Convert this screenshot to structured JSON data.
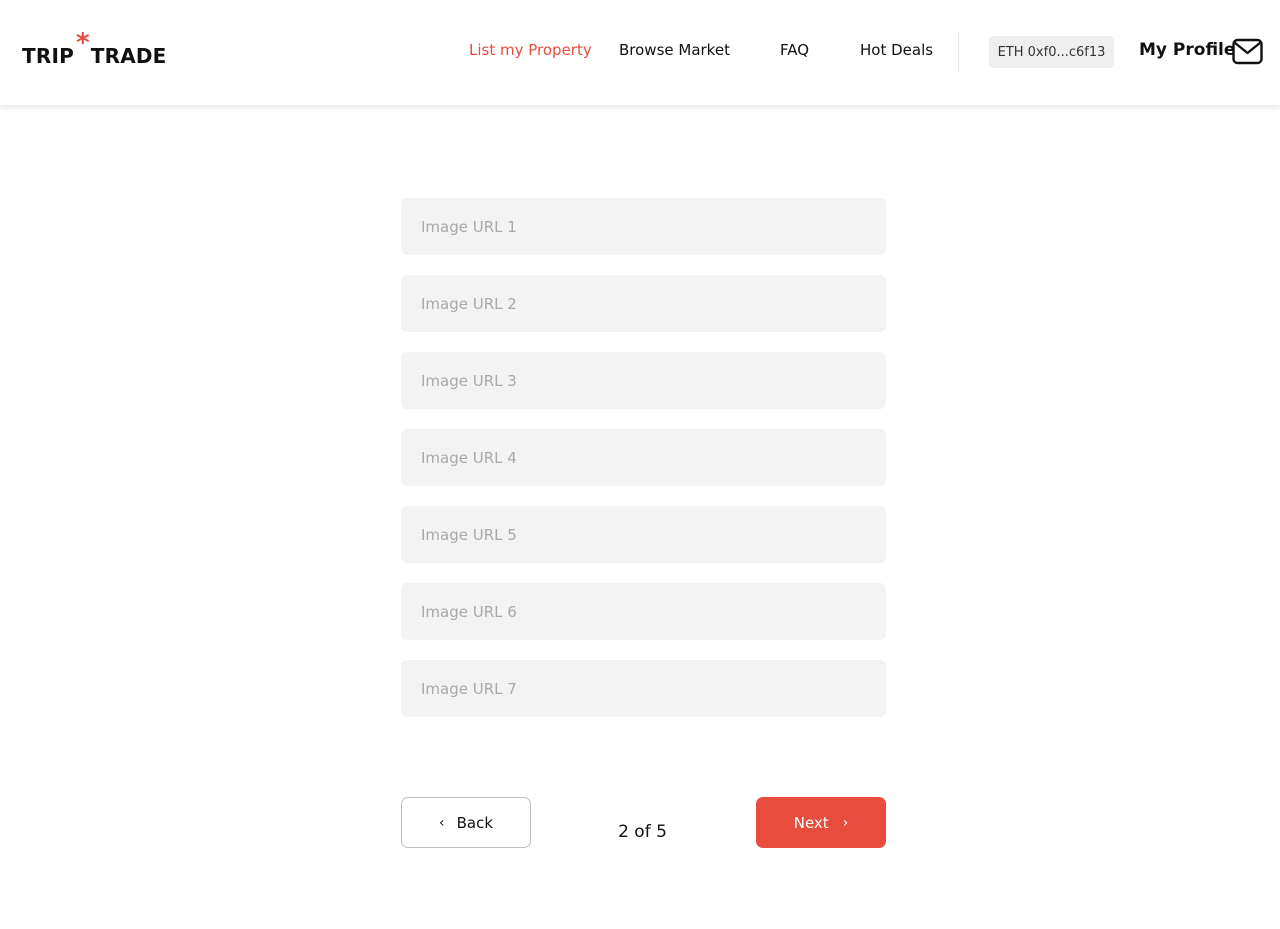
{
  "brand": {
    "logo_left": "TRIP",
    "logo_star": "*",
    "logo_right": "TRADE"
  },
  "nav": {
    "items": [
      {
        "label": "List my Property",
        "active": true
      },
      {
        "label": "Browse Market",
        "active": false
      },
      {
        "label": "FAQ",
        "active": false
      },
      {
        "label": "Hot Deals",
        "active": false
      }
    ],
    "wallet": "ETH 0xf0...c6f13",
    "profile": "My Profile",
    "mail_icon": "mail-icon"
  },
  "form": {
    "fields": [
      {
        "placeholder": "Image URL 1",
        "value": ""
      },
      {
        "placeholder": "Image URL 2",
        "value": ""
      },
      {
        "placeholder": "Image URL 3",
        "value": ""
      },
      {
        "placeholder": "Image URL 4",
        "value": ""
      },
      {
        "placeholder": "Image URL 5",
        "value": ""
      },
      {
        "placeholder": "Image URL 6",
        "value": ""
      },
      {
        "placeholder": "Image URL 7",
        "value": ""
      }
    ]
  },
  "footer": {
    "back_chevron": "‹",
    "back_label": "Back",
    "step": "2 of 5",
    "next_label": "Next",
    "next_chevron": "›"
  },
  "colors": {
    "accent": "#e84c3d",
    "field_bg": "#f3f3f3",
    "text": "#111111"
  }
}
